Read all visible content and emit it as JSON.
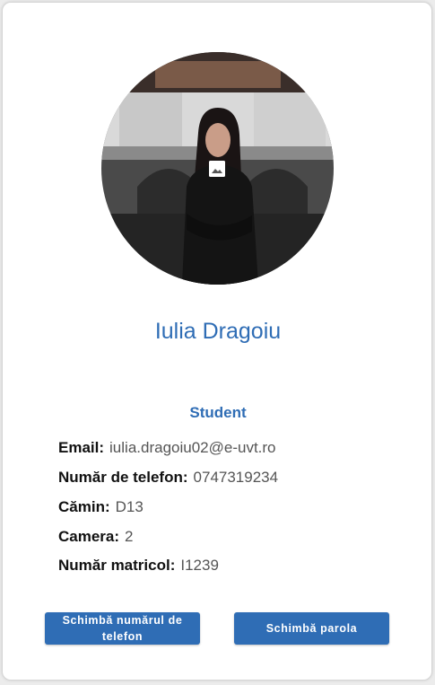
{
  "profile": {
    "name": "Iulia Dragoiu",
    "role": "Student",
    "photo_icon": "image-icon"
  },
  "info": [
    {
      "label": "Email:",
      "value": "iulia.dragoiu02@e-uvt.ro"
    },
    {
      "label": "Număr de telefon:",
      "value": "0747319234"
    },
    {
      "label": "Cămin:",
      "value": "D13"
    },
    {
      "label": "Camera:",
      "value": "2"
    },
    {
      "label": "Număr matricol:",
      "value": "I1239"
    }
  ],
  "actions": {
    "change_phone_label": "Schimbă numărul de telefon",
    "change_password_label": "Schimbă parola"
  },
  "colors": {
    "accent": "#2f6db5",
    "background": "#ffffff"
  }
}
